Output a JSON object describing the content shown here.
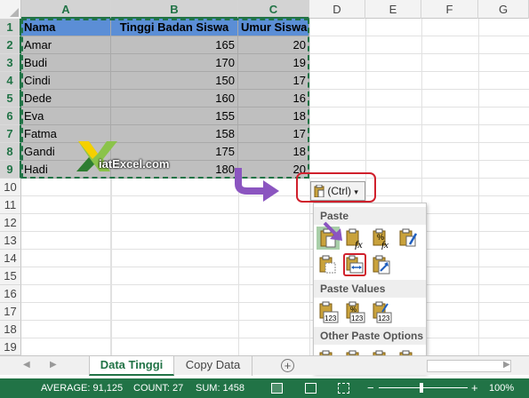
{
  "columns": [
    "A",
    "B",
    "C",
    "D",
    "E",
    "F",
    "G"
  ],
  "rows": [
    "1",
    "2",
    "3",
    "4",
    "5",
    "6",
    "7",
    "8",
    "9",
    "10",
    "11",
    "12",
    "13",
    "14",
    "15",
    "16",
    "17",
    "18",
    "19"
  ],
  "table": {
    "headers": [
      "Nama",
      "Tinggi Badan Siswa",
      "Umur Siswa"
    ],
    "data": [
      [
        "Amar",
        "165",
        "20"
      ],
      [
        "Budi",
        "170",
        "19"
      ],
      [
        "Cindi",
        "150",
        "17"
      ],
      [
        "Dede",
        "160",
        "16"
      ],
      [
        "Eva",
        "155",
        "18"
      ],
      [
        "Fatma",
        "158",
        "17"
      ],
      [
        "Gandi",
        "175",
        "18"
      ],
      [
        "Hadi",
        "180",
        "20"
      ]
    ]
  },
  "logo": {
    "text": "iatExcel.com"
  },
  "paste_button": {
    "label": "(Ctrl)",
    "caret": "▾"
  },
  "paste_menu": {
    "paste_label": "Paste",
    "paste_values_label": "Paste Values",
    "other_label": "Other Paste Options",
    "paste_icons": [
      "paste-icon",
      "paste-formulas-icon",
      "paste-formulas-number-format-icon",
      "paste-keep-source-formatting-icon",
      "paste-no-borders-icon",
      "paste-keep-column-widths-icon",
      "paste-transpose-icon"
    ],
    "value_icons": [
      "paste-values-icon",
      "paste-values-number-format-icon",
      "paste-values-source-formatting-icon"
    ],
    "other_icons": [
      "paste-formatting-icon",
      "paste-link-icon",
      "paste-picture-icon",
      "paste-linked-picture-icon"
    ]
  },
  "sheets": {
    "active": "Data Tinggi",
    "other": "Copy Data",
    "add": "+"
  },
  "status": {
    "average": "AVERAGE: 91,125",
    "count": "COUNT: 27",
    "sum": "SUM: 1458",
    "zoom": "100%"
  },
  "colors": {
    "accent": "#217346",
    "header_fill": "#5b8ed6",
    "highlight": "#d0202c",
    "arrow": "#8b55c0"
  }
}
